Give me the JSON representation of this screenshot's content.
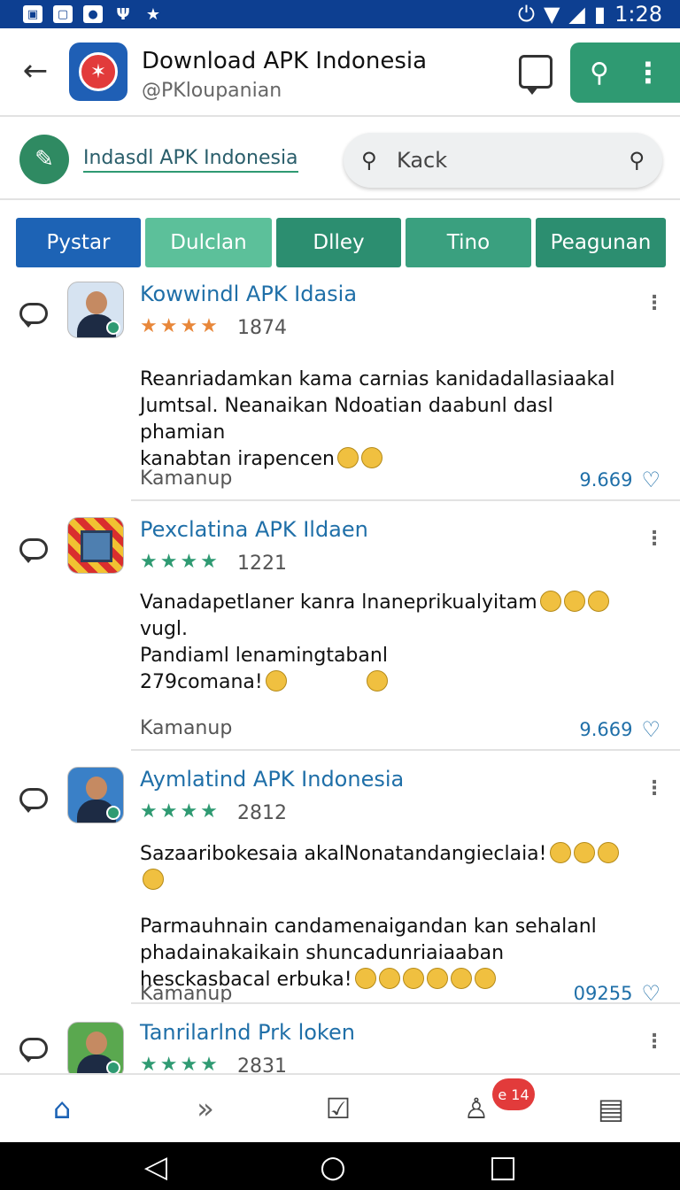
{
  "status_bar": {
    "time": "1:28",
    "left_icons": [
      "photo-icon",
      "message-icon",
      "app-icon",
      "usb-icon",
      "star-icon"
    ],
    "right_icons": [
      "alarm-icon",
      "wifi-icon",
      "signal-icon",
      "battery-icon"
    ]
  },
  "header": {
    "title": "Download APK Indonesia",
    "subtitle": "@PKloupanian"
  },
  "search_row": {
    "link_text": "Indasdl APK Indonesia",
    "search_value": "Kack"
  },
  "tabs": [
    {
      "label": "Pystar"
    },
    {
      "label": "Dulclan"
    },
    {
      "label": "Dlley"
    },
    {
      "label": "Tino"
    },
    {
      "label": "Peagunan"
    }
  ],
  "posts": [
    {
      "title": "Kowwindl APK Idasia",
      "score": "1874",
      "lines": [
        "Reanriadamkan kama carnias kanidadallasiaakal",
        "Jumtsal. Neanaikan Ndoatian daabunl dasl phamian",
        "kanabtan irapencen"
      ],
      "meta": "Kamanup",
      "count": "9.669"
    },
    {
      "title": "Pexclatina APK Ildaen",
      "score": "1221",
      "lines": [
        "Vanadapetlaner kanra lnaneprikualyitam",
        "vugl.",
        "Pandiaml lenamingtabanl",
        "279comana!"
      ],
      "meta": "Kamanup",
      "count": "9.669"
    },
    {
      "title": "Aymlatind APK Indonesia",
      "score": "2812",
      "lines": [
        "Sazaaribokesaia akalNonatandangieclaia!",
        "",
        "Parmauhnain candamenaigandan kan sehalanl",
        "phadainakaikain shuncadunriaiaaban",
        "hesckasbacal erbuka!"
      ],
      "meta": "Kamanup",
      "count": "09255"
    },
    {
      "title": "Tanrilarlnd Prk loken",
      "score": "2831"
    }
  ],
  "bottom_nav": {
    "badge": "e 14"
  },
  "colors": {
    "primary_blue": "#1d63b5",
    "accent_green": "#2f9a72",
    "status_bar": "#0d3f91",
    "badge_red": "#e23b3b"
  }
}
